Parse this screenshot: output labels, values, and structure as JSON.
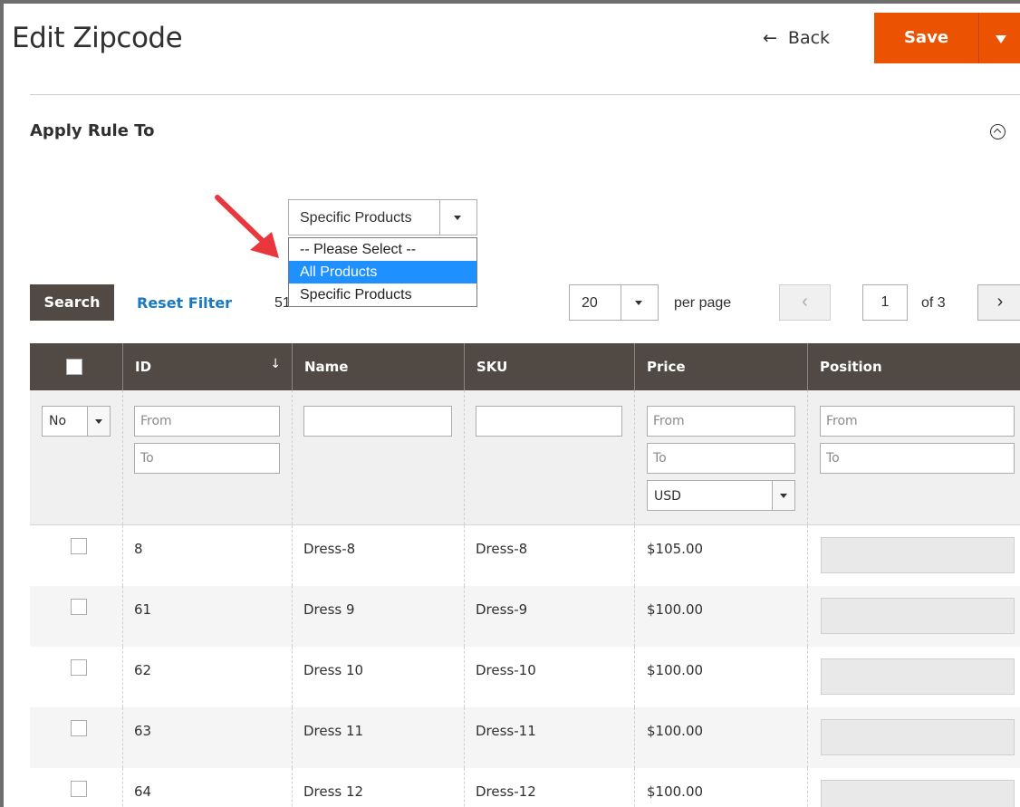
{
  "header": {
    "title": "Edit Zipcode",
    "back_label": "Back",
    "back_arrow": "←",
    "save_label": "Save"
  },
  "section": {
    "title": "Apply Rule To"
  },
  "apply_select": {
    "value": "Specific Products",
    "options": [
      {
        "label": "-- Please Select --"
      },
      {
        "label": "All Products",
        "highlighted": true
      },
      {
        "label": "Specific Products"
      }
    ]
  },
  "toolbar": {
    "search_label": "Search",
    "reset_label": "Reset Filter",
    "records_text": "51 records found",
    "per_page_value": "20",
    "per_page_label": "per page",
    "page_value": "1",
    "of_label": "of 3",
    "prev": "‹",
    "next": "›"
  },
  "grid": {
    "columns": [
      "ID",
      "Name",
      "SKU",
      "Price",
      "Position"
    ],
    "sort_indicator": "↓",
    "filters": {
      "in_products": "No",
      "id_from": "From",
      "id_to": "To",
      "price_from": "From",
      "price_to": "To",
      "currency": "USD",
      "position_from": "From",
      "position_to": "To"
    },
    "rows": [
      {
        "id": "8",
        "name": "Dress-8",
        "sku": "Dress-8",
        "price": "$105.00"
      },
      {
        "id": "61",
        "name": "Dress 9",
        "sku": "Dress-9",
        "price": "$100.00"
      },
      {
        "id": "62",
        "name": "Dress 10",
        "sku": "Dress-10",
        "price": "$100.00"
      },
      {
        "id": "63",
        "name": "Dress 11",
        "sku": "Dress-11",
        "price": "$100.00"
      },
      {
        "id": "64",
        "name": "Dress 12",
        "sku": "Dress-12",
        "price": "$100.00"
      }
    ]
  },
  "colors": {
    "accent": "#eb5202",
    "header_bg": "#514943",
    "link": "#1979c3",
    "highlight": "#1e90ff",
    "annotation_arrow": "#e8383d"
  }
}
